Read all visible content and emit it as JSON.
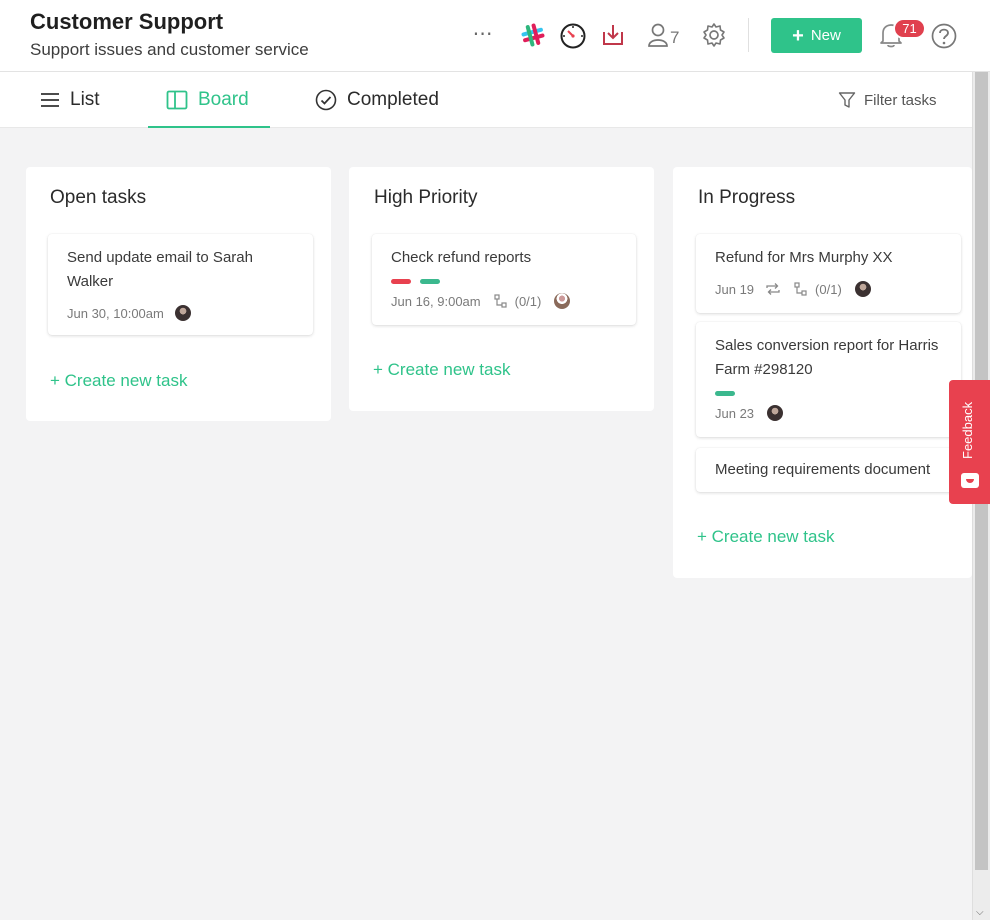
{
  "header": {
    "title": "Customer Support",
    "subtitle": "Support issues and customer service",
    "members_count": "7",
    "new_label": "New",
    "notifications_count": "71"
  },
  "tabs": {
    "list": "List",
    "board": "Board",
    "completed": "Completed",
    "filter": "Filter tasks"
  },
  "columns": [
    {
      "title": "Open tasks",
      "create_label": "+ Create new task",
      "cards": [
        {
          "title": "Send update email to Sarah Walker",
          "date": "Jun 30, 10:00am"
        }
      ]
    },
    {
      "title": "High Priority",
      "create_label": "+ Create new task",
      "cards": [
        {
          "title": "Check refund reports",
          "date": "Jun 16, 9:00am",
          "subtasks": "(0/1)",
          "tags": [
            "#e8414f",
            "#3bb88e"
          ]
        }
      ]
    },
    {
      "title": "In Progress",
      "create_label": "+ Create new task",
      "cards": [
        {
          "title": "Refund for Mrs Murphy XX",
          "date": "Jun 19",
          "subtasks": "(0/1)"
        },
        {
          "title": "Sales conversion report for Harris Farm #298120",
          "date": "Jun 23",
          "tags": [
            "#3bb88e"
          ]
        },
        {
          "title": "Meeting requirements document"
        }
      ]
    }
  ],
  "feedback_label": "Feedback",
  "colors": {
    "accent": "#2fc38a",
    "danger": "#e0404e"
  }
}
